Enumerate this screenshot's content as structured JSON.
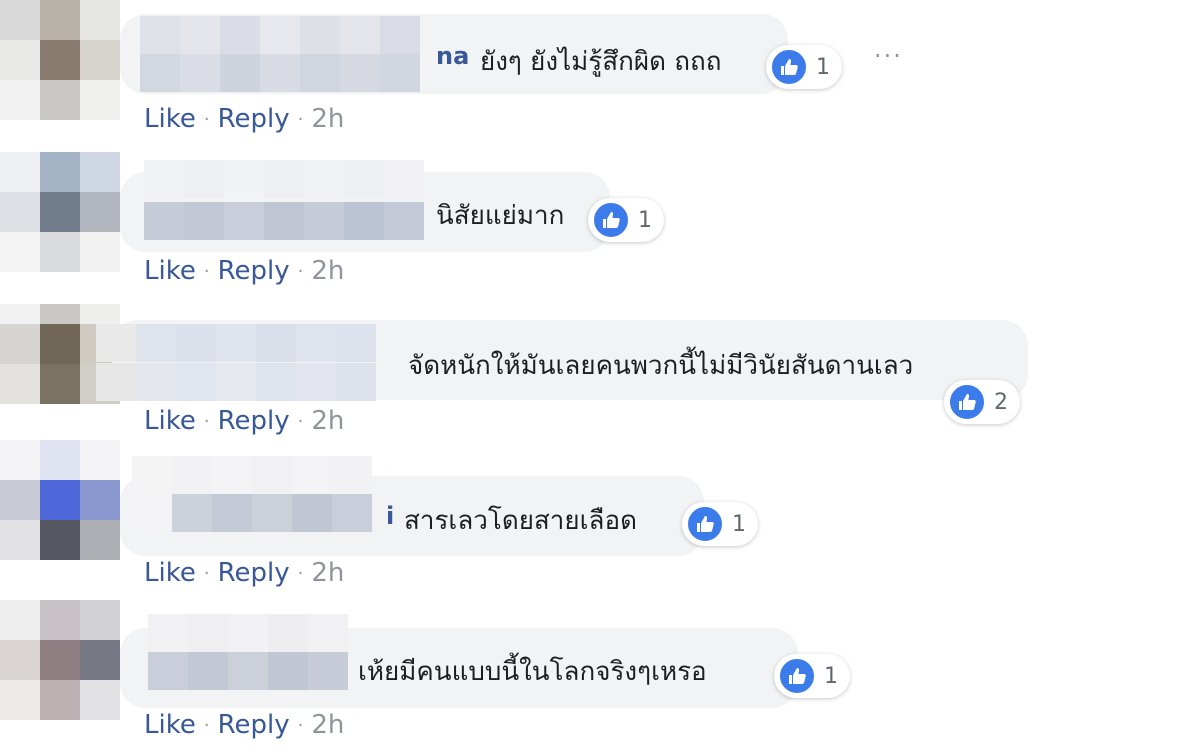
{
  "comments": [
    {
      "name_fragment": "na",
      "text": "ยังๆ ยังไม่รู้สึกผิด ถถถ",
      "like_count": "1",
      "show_more": true
    },
    {
      "name_fragment": "",
      "text": "นิสัยแย่มาก",
      "like_count": "1",
      "show_more": false
    },
    {
      "name_fragment": "",
      "text": "จัดหนักให้มันเลยคนพวกนี้ไม่มีวินัยสันดานเลว",
      "like_count": "2",
      "show_more": false
    },
    {
      "name_fragment": "i",
      "text": "สารเลวโดยสายเลือด",
      "like_count": "1",
      "show_more": false
    },
    {
      "name_fragment": "",
      "text": "เห้ยมีคนแบบนี้ในโลกจริงๆเหรอ",
      "like_count": "1",
      "show_more": false
    }
  ],
  "actions": {
    "like_label": "Like",
    "reply_label": "Reply",
    "separator": "·",
    "time": "2h"
  },
  "more_label": "···",
  "colors": {
    "bubble": "#f2f3f5",
    "link": "#385898",
    "like_icon": "#3b7bea",
    "meta": "#90949c"
  },
  "icons": {
    "reaction": "thumbs-up-icon",
    "more": "more-horizontal-icon"
  }
}
